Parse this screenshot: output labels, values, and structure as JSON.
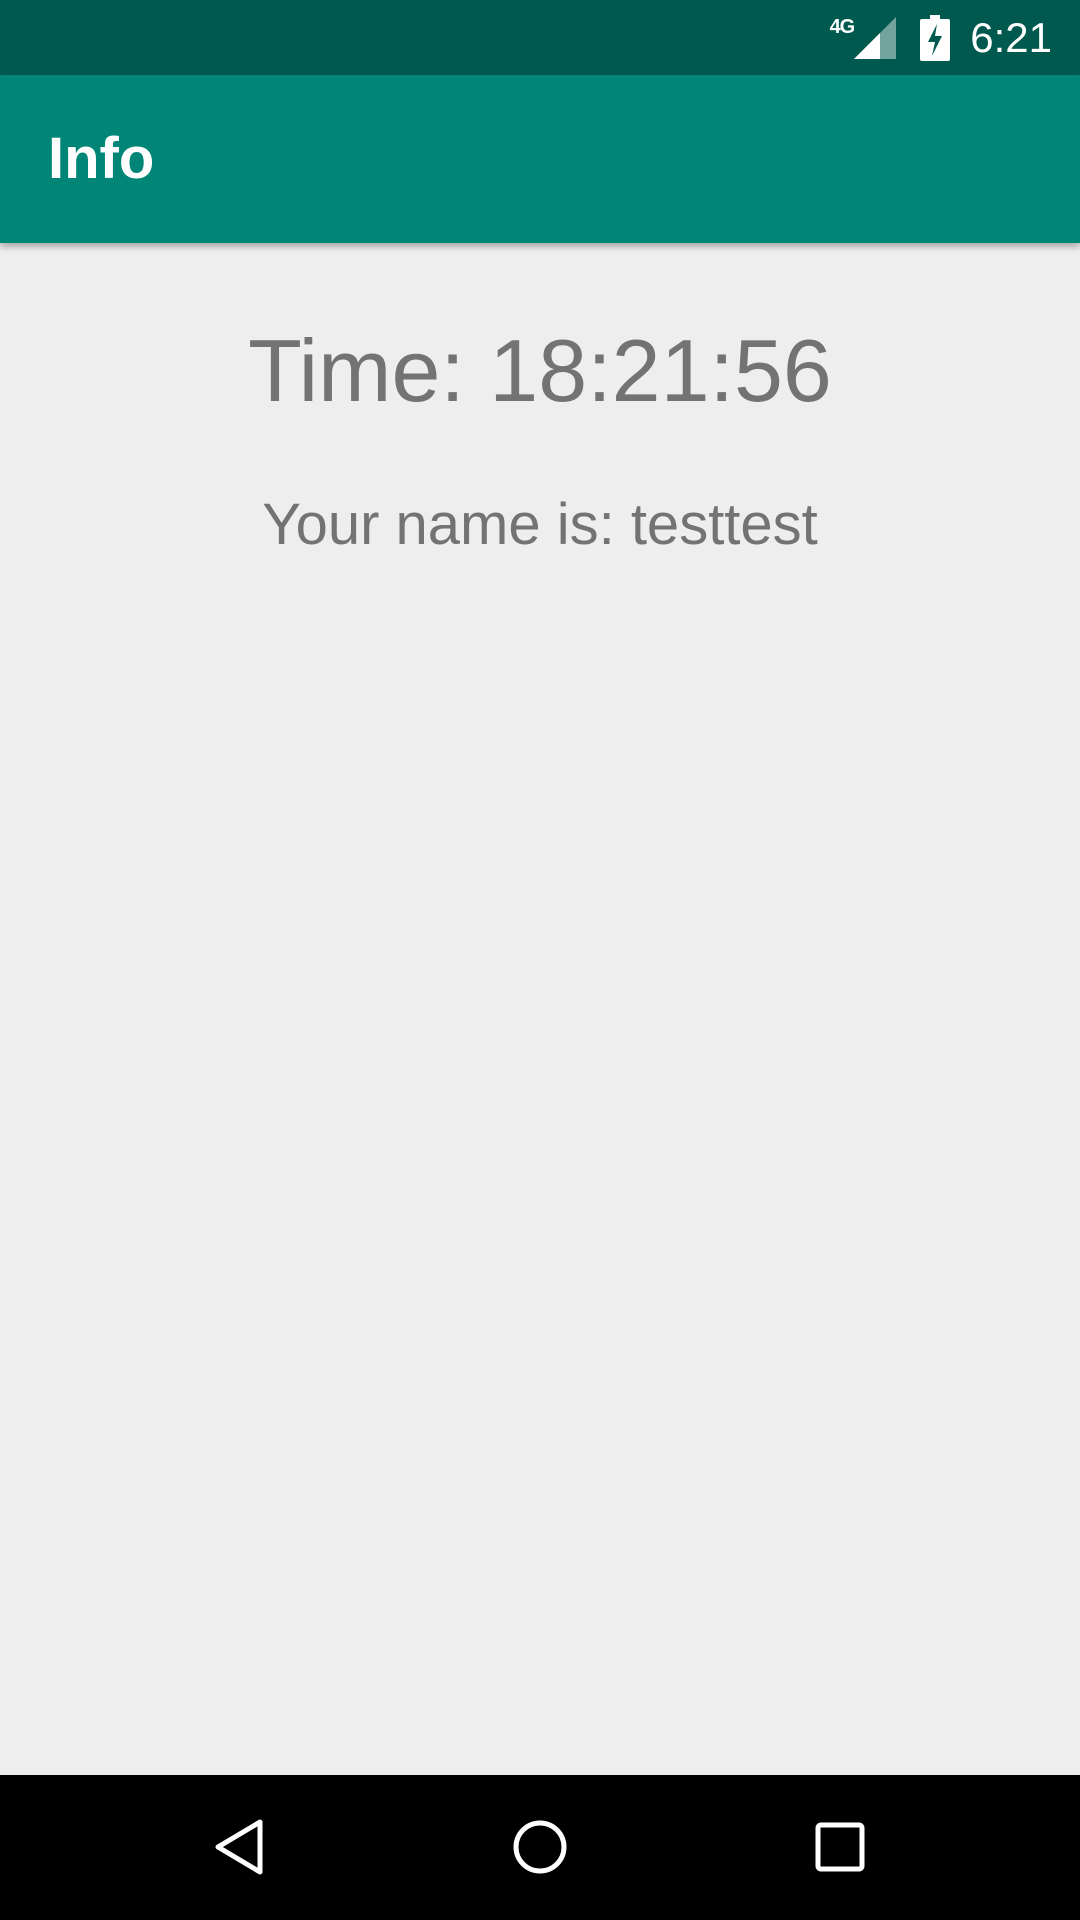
{
  "status_bar": {
    "network_label": "4G",
    "time": "6:21",
    "icons": [
      "signal-icon",
      "battery-charging-icon"
    ]
  },
  "app_bar": {
    "title": "Info"
  },
  "content": {
    "time_text": "Time: 18:21:56",
    "name_text": "Your name is: testtest"
  },
  "nav_bar": {
    "icons": [
      "back-icon",
      "home-icon",
      "recents-icon"
    ]
  },
  "colors": {
    "status_bar": "#00594f",
    "app_bar": "#008577",
    "background": "#eeeeee",
    "text": "#737373",
    "nav_bar": "#000000"
  }
}
